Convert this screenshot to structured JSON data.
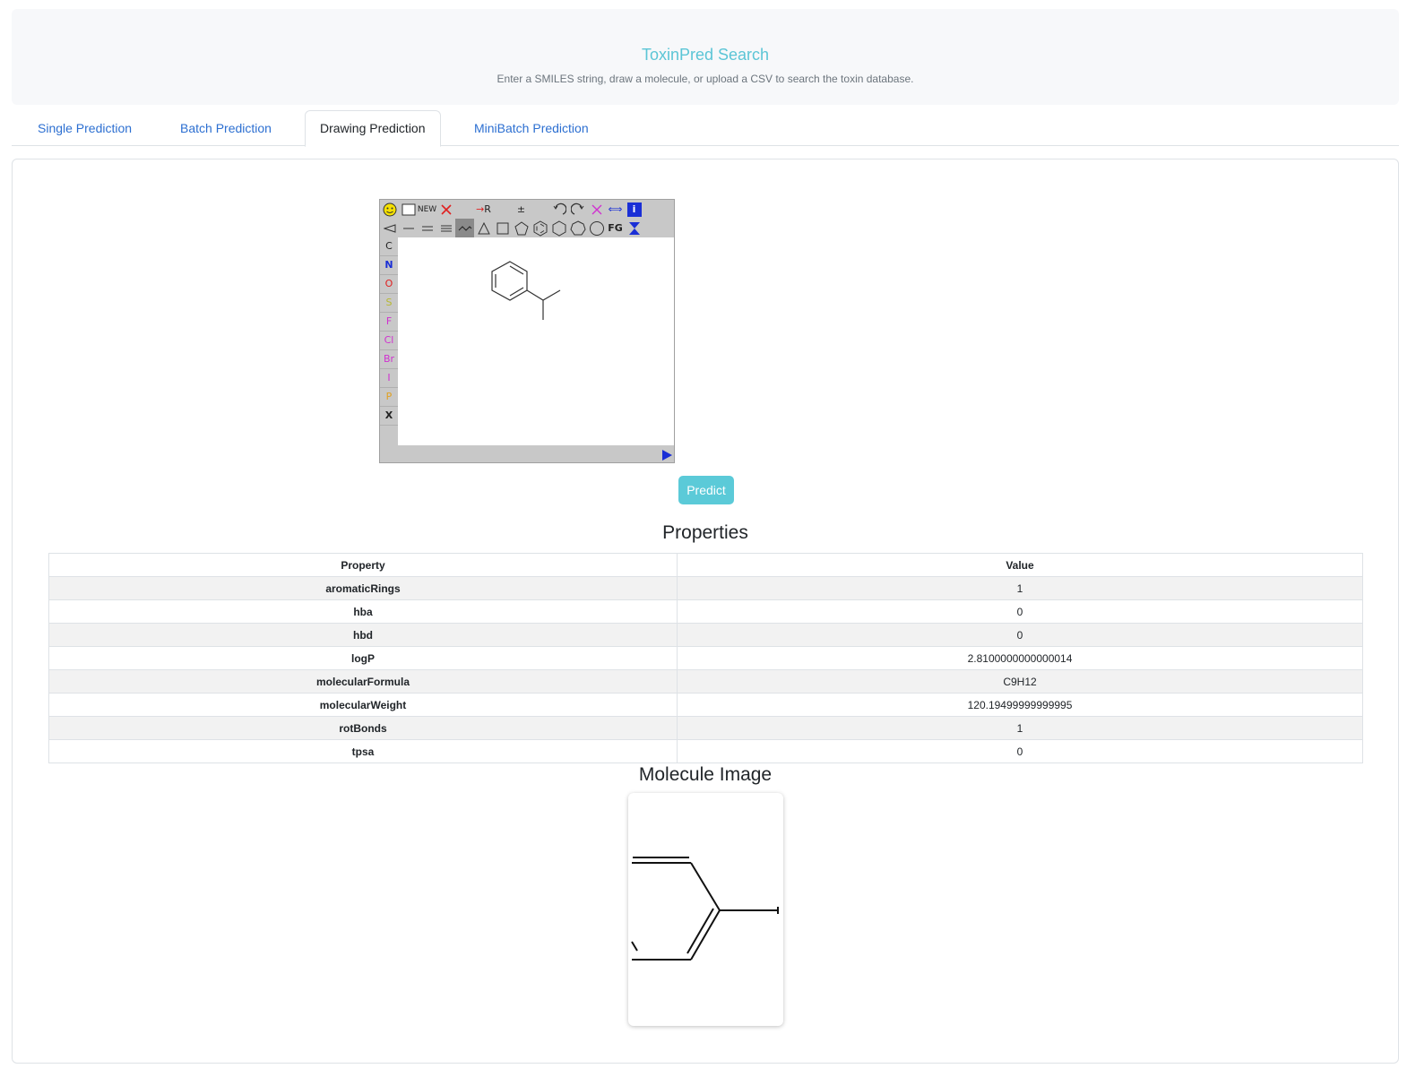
{
  "header": {
    "title": "ToxinPred Search",
    "subtitle": "Enter a SMILES string, draw a molecule, or upload a CSV to search the toxin database."
  },
  "tabs": [
    {
      "label": "Single Prediction",
      "active": false
    },
    {
      "label": "Batch Prediction",
      "active": false
    },
    {
      "label": "Drawing Prediction",
      "active": true
    },
    {
      "label": "MiniBatch Prediction",
      "active": false
    }
  ],
  "editor": {
    "new_label": "NEW",
    "r_label": "R",
    "fg_label": "FG",
    "info_label": "i",
    "atoms": [
      {
        "label": "C",
        "color": "#222222"
      },
      {
        "label": "N",
        "color": "#1a2fd6"
      },
      {
        "label": "O",
        "color": "#e02020"
      },
      {
        "label": "S",
        "color": "#b8b830"
      },
      {
        "label": "F",
        "color": "#d030d0"
      },
      {
        "label": "Cl",
        "color": "#d030d0"
      },
      {
        "label": "Br",
        "color": "#d030d0"
      },
      {
        "label": "I",
        "color": "#d030d0"
      },
      {
        "label": "P",
        "color": "#e0a020"
      },
      {
        "label": "X",
        "color": "#222222"
      }
    ]
  },
  "predict_button": "Predict",
  "properties": {
    "title": "Properties",
    "headers": [
      "Property",
      "Value"
    ],
    "rows": [
      {
        "property": "aromaticRings",
        "value": "1"
      },
      {
        "property": "hba",
        "value": "0"
      },
      {
        "property": "hbd",
        "value": "0"
      },
      {
        "property": "logP",
        "value": "2.8100000000000014"
      },
      {
        "property": "molecularFormula",
        "value": "C9H12"
      },
      {
        "property": "molecularWeight",
        "value": "120.19499999999995"
      },
      {
        "property": "rotBonds",
        "value": "1"
      },
      {
        "property": "tpsa",
        "value": "0"
      }
    ]
  },
  "molecule_image": {
    "title": "Molecule Image"
  },
  "colors": {
    "accent": "#5bc5d6",
    "tab_link": "#2c6fd1",
    "predict_button": "#5bcad8"
  }
}
